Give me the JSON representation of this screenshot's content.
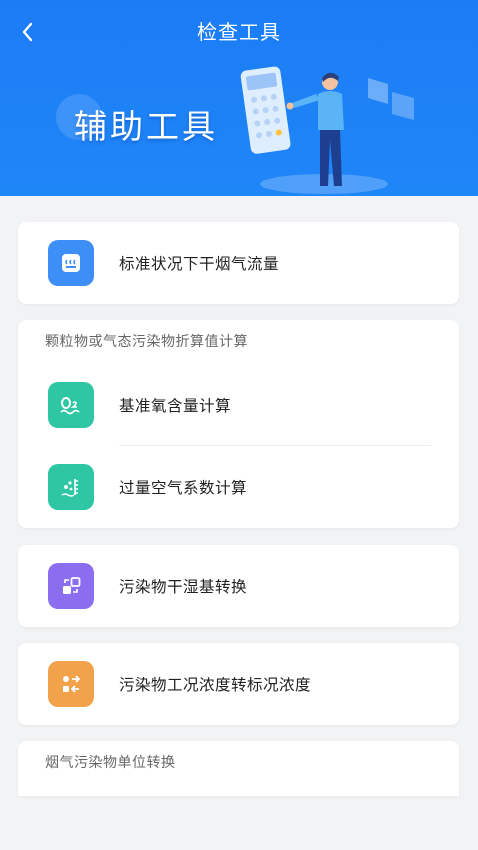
{
  "header": {
    "title": "检查工具",
    "back_icon": "chevron-left-icon"
  },
  "banner": {
    "text": "辅助工具"
  },
  "colors": {
    "header_blue": "#1c7cf5",
    "icon_blue": "#3d8ef6",
    "icon_teal": "#2fc6a3",
    "icon_purple": "#8b6df0",
    "icon_orange": "#f1a24a"
  },
  "items": {
    "flue_gas_flow": {
      "label": "标准状况下干烟气流量",
      "icon": "flue-gas-icon"
    },
    "oxygen_calc": {
      "label": "基准氧含量计算",
      "icon": "oxygen-icon"
    },
    "excess_air": {
      "label": "过量空气系数计算",
      "icon": "excess-air-icon"
    },
    "wet_dry": {
      "label": "污染物干湿基转换",
      "icon": "convert-icon"
    },
    "concentration": {
      "label": "污染物工况浓度转标况浓度",
      "icon": "exchange-icon"
    }
  },
  "sections": {
    "conversion_calc": "颗粒物或气态污染物折算值计算",
    "unit_conversion": "烟气污染物单位转换"
  }
}
